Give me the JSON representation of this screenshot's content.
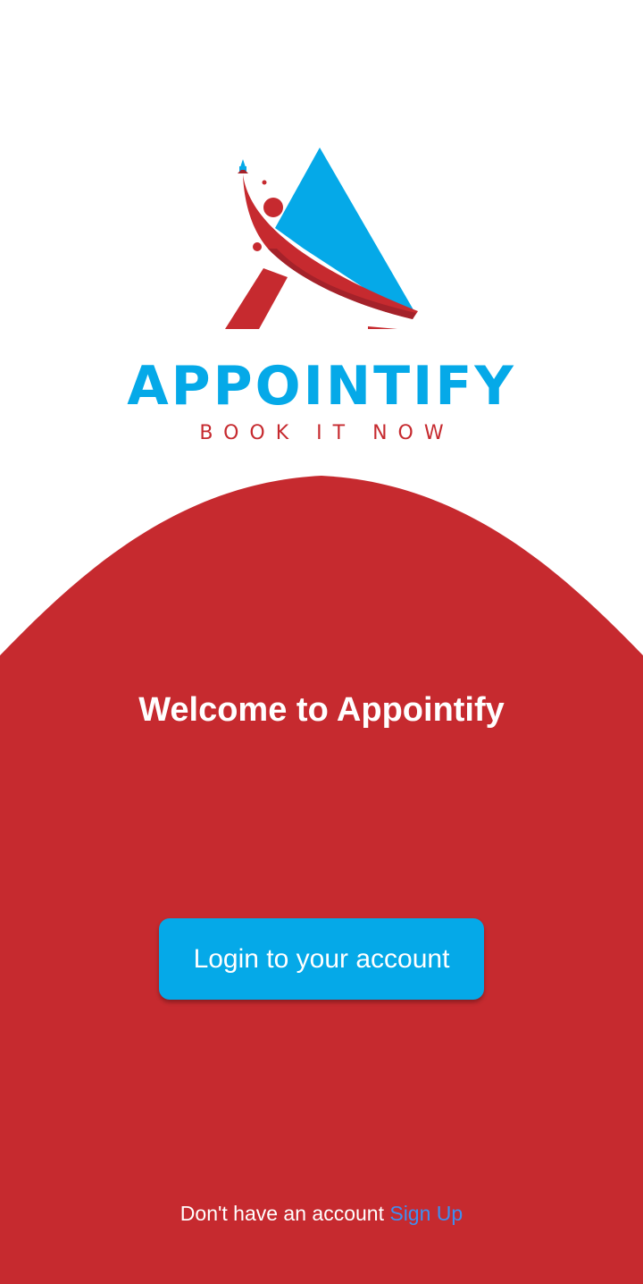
{
  "colors": {
    "background": "#ffffff",
    "primary_red": "#c62a2f",
    "brand_blue": "#05a9e8",
    "dark_red": "#a4222a",
    "link_blue": "#3f8ff0",
    "white": "#ffffff"
  },
  "logo": {
    "icon": "appointify-a-rocket-logo",
    "brand_name": "APPOINTIFY",
    "tagline": "BOOK IT NOW"
  },
  "main": {
    "welcome_text": "Welcome to Appointify",
    "login_button_label": "Login to your account"
  },
  "footer": {
    "prompt_text": "Don't have an account",
    "signup_link": "Sign Up"
  }
}
